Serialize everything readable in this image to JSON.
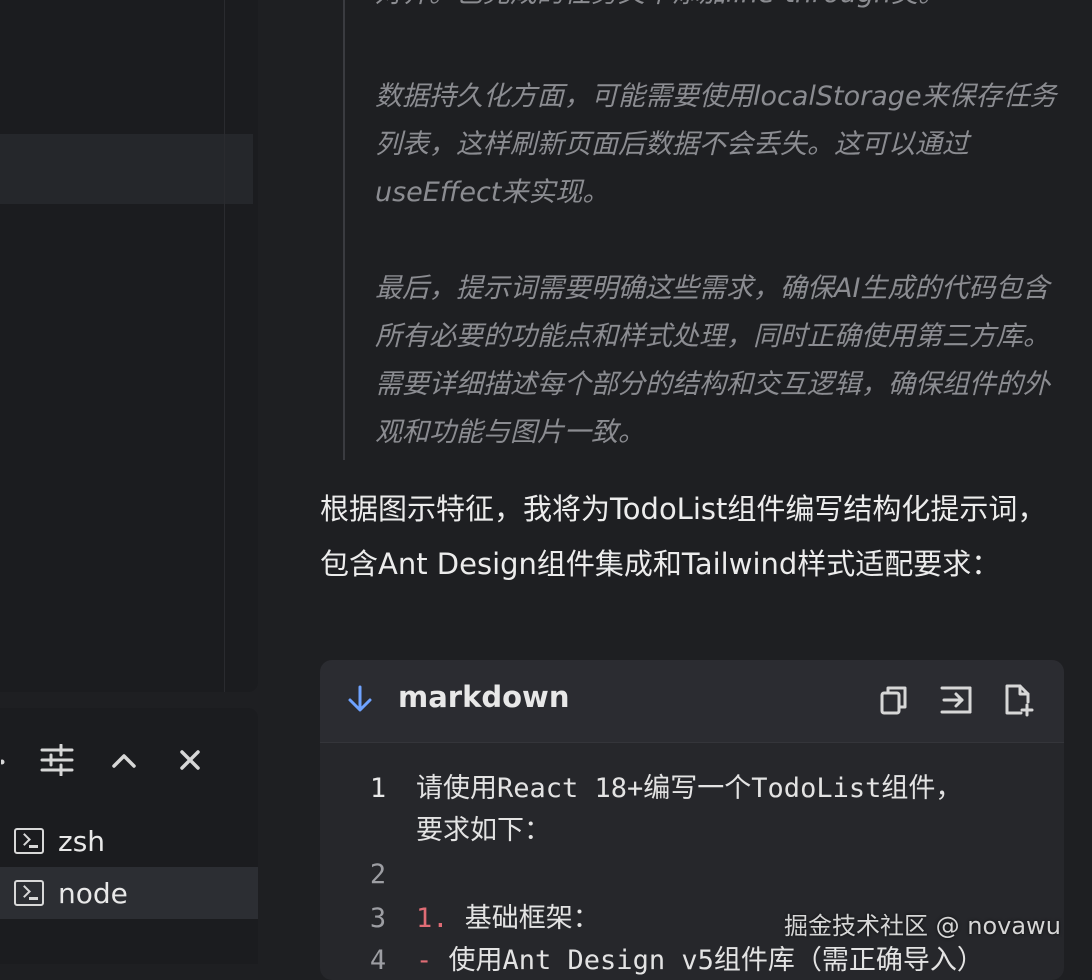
{
  "thinking": {
    "line_cut": "对齐。已完成的任务文本添加line-through类。",
    "para1": "数据持久化方面，可能需要使用localStorage来保存任务列表，这样刷新页面后数据不会丢失。这可以通过useEffect来实现。",
    "para2": "最后，提示词需要明确这些需求，确保AI生成的代码包含所有必要的功能点和样式处理，同时正确使用第三方库。需要详细描述每个部分的结构和交互逻辑，确保组件的外观和功能与图片一致。"
  },
  "answer": {
    "text": "根据图示特征，我将为TodoList组件编写结构化提示词，包含Ant Design组件集成和Tailwind样式适配要求："
  },
  "code_block": {
    "language": "markdown",
    "lines": [
      {
        "num": "1",
        "text": "请使用React 18+编写一个TodoList组件，",
        "text2": "要求如下："
      },
      {
        "num": "2",
        "text": ""
      },
      {
        "num": "3",
        "prefix": "1.",
        "text": " 基础框架："
      },
      {
        "num": "4",
        "prefix": "-",
        "text": " 使用Ant Design v5组件库（需正确导入）"
      }
    ]
  },
  "terminal": {
    "sessions": [
      {
        "label": "zsh",
        "active": false
      },
      {
        "label": "node",
        "active": true
      }
    ]
  },
  "icons": {
    "collapse": "download-arrow-icon",
    "copy": "copy-icon",
    "insert": "insert-into-terminal-icon",
    "new_file": "new-file-icon",
    "settings": "sliders-icon",
    "maximize": "chevron-up-icon",
    "close": "close-icon"
  },
  "watermark": "掘金技术社区 @ novawu"
}
